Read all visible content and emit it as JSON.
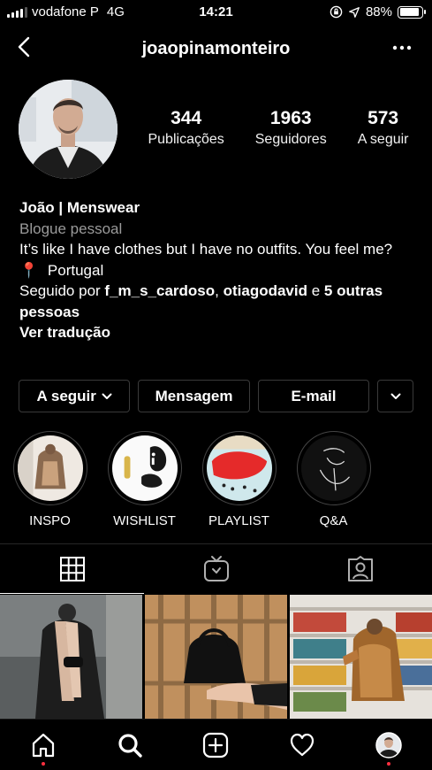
{
  "status_bar": {
    "carrier": "vodafone P",
    "network": "4G",
    "time": "14:21",
    "battery": "88%",
    "battery_level": 0.88
  },
  "nav": {
    "username": "joaopinamonteiro"
  },
  "stats": [
    {
      "value": "344",
      "label": "Publicações"
    },
    {
      "value": "1963",
      "label": "Seguidores"
    },
    {
      "value": "573",
      "label": "A seguir"
    }
  ],
  "bio": {
    "name": "João | Menswear",
    "category": "Blogue pessoal",
    "text": "It’s like I have clothes but I have no outfits. You feel me?",
    "location_emoji": "📍",
    "location": "Portugal",
    "followed_prefix": "Seguido por ",
    "followed_user1": "f_m_s_cardoso",
    "followed_sep": ", ",
    "followed_user2": "otiagodavid",
    "followed_and": " e ",
    "followed_others": "5 outras pessoas",
    "translate": "Ver tradução"
  },
  "buttons": {
    "following": "A seguir",
    "message": "Mensagem",
    "email": "E-mail"
  },
  "highlights": [
    {
      "label": "INSPO"
    },
    {
      "label": "WISHLIST"
    },
    {
      "label": "PLAYLIST"
    },
    {
      "label": "Q&A"
    }
  ],
  "colors": {
    "background": "#000000",
    "notification_dot": "#ff3040",
    "button_border": "#3a3a3a",
    "secondary_text": "#9a9a9a"
  },
  "icons": {
    "back": "chevron-left-icon",
    "more": "more-dots-icon",
    "grid_tab": "grid-icon",
    "igtv_tab": "igtv-icon",
    "tagged_tab": "tagged-icon",
    "home": "home-icon",
    "search": "search-icon",
    "new_post": "add-post-icon",
    "activity": "heart-icon",
    "profile": "avatar"
  }
}
